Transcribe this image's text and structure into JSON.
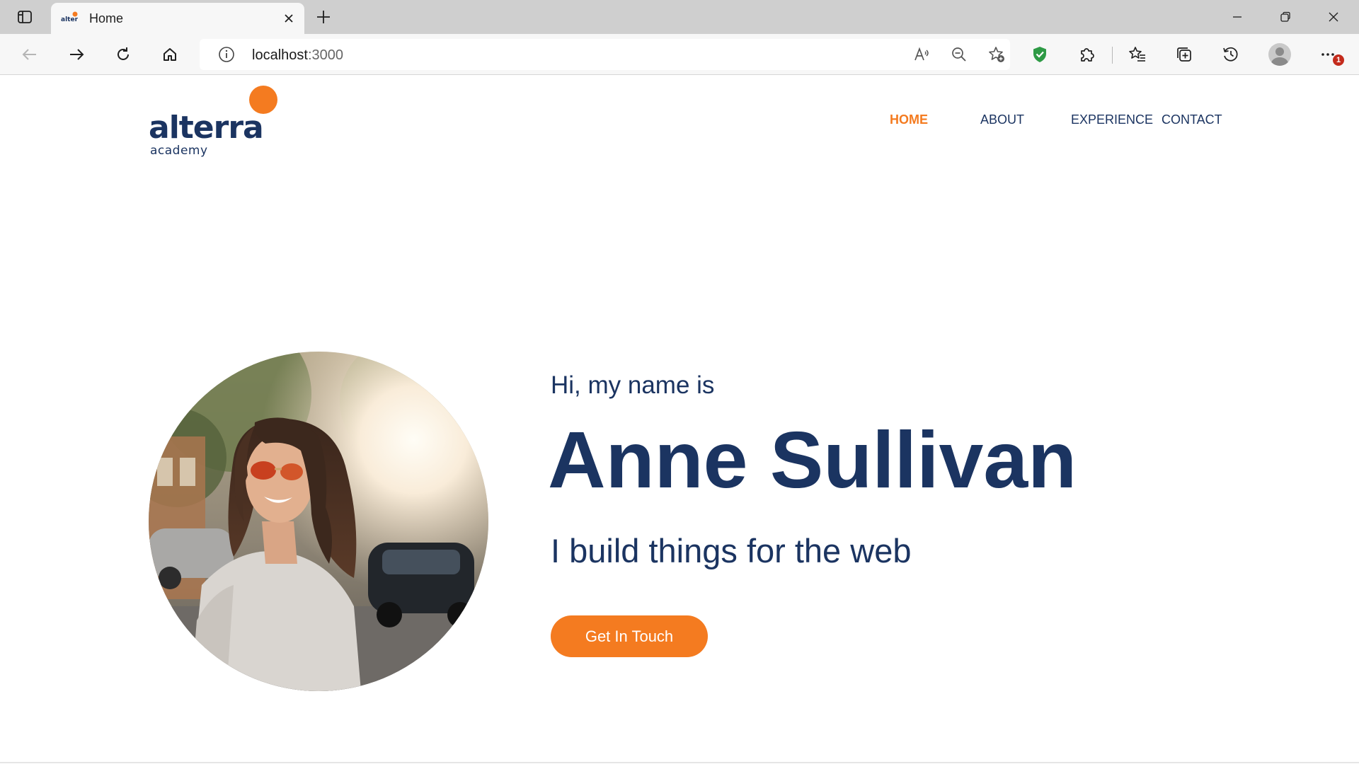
{
  "browser": {
    "tab_title": "Home",
    "address": {
      "host": "localhost",
      "port": ":3000"
    },
    "notification_count": "1"
  },
  "site": {
    "logo": {
      "word": "alterra",
      "sub": "academy"
    },
    "nav": [
      {
        "label": "HOME",
        "active": true
      },
      {
        "label": "ABOUT",
        "active": false
      },
      {
        "label": "EXPERIENCE",
        "active": false
      },
      {
        "label": "CONTACT",
        "active": false
      }
    ],
    "hero": {
      "greeting": "Hi, my name is",
      "name": "Anne Sullivan",
      "tagline": "I build things for the web",
      "cta_label": "Get In Touch"
    },
    "colors": {
      "brand_navy": "#1b3461",
      "brand_orange": "#f47b20"
    }
  }
}
